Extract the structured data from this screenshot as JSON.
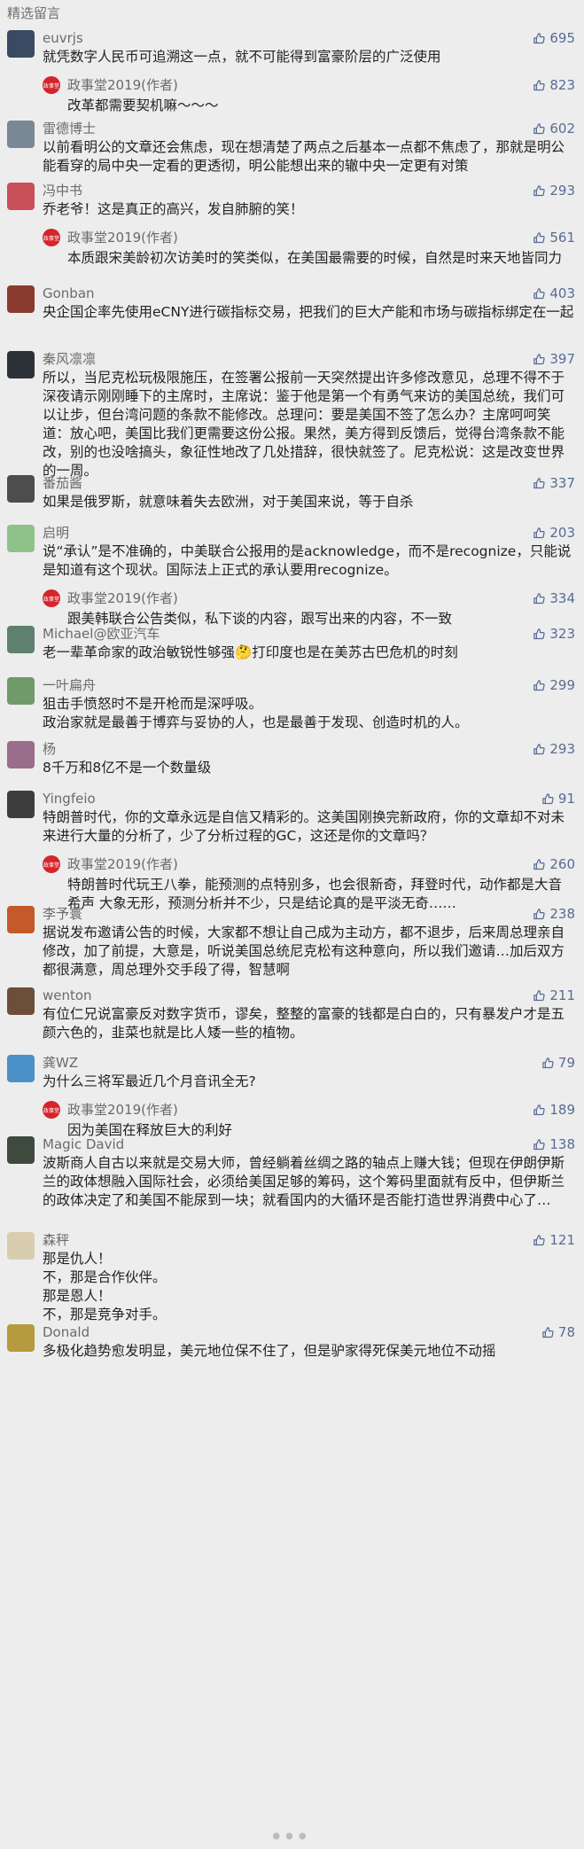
{
  "section_title": "精选留言",
  "comments": [
    {
      "nick": "euvrjs",
      "likes": "695",
      "text": "就凭数字人民币可追溯这一点，就不可能得到富豪阶层的广泛使用",
      "avatar_color": "#3a4a63",
      "reply": {
        "nick": "政事堂2019(作者)",
        "likes": "823",
        "text": "改革都需要契机嘛～～～"
      }
    },
    {
      "nick": "雷德博士",
      "likes": "602",
      "text": "以前看明公的文章还会焦虑，现在想清楚了两点之后基本一点都不焦虑了，那就是明公能看穿的局中央一定看的更透彻，明公能想出来的辙中央一定更有对策",
      "avatar_color": "#7a8794"
    },
    {
      "nick": "冯中书",
      "likes": "293",
      "text": "乔老爷！这是真正的高兴，发自肺腑的笑！",
      "avatar_color": "#c7505a",
      "reply": {
        "nick": "政事堂2019(作者)",
        "likes": "561",
        "text": "本质跟宋美龄初次访美时的笑类似，在美国最需要的时候，自然是时来天地皆同力"
      }
    },
    {
      "nick": "Gonban",
      "likes": "403",
      "text": "央企国企率先使用eCNY进行碳指标交易，把我们的巨大产能和市场与碳指标绑定在一起",
      "avatar_color": "#8a3a2e"
    },
    {
      "nick": "秦风凛凛",
      "likes": "397",
      "text": "所以，当尼克松玩极限施压，在签署公报前一天突然提出许多修改意见，总理不得不于深夜请示刚刚睡下的主席时，主席说：鉴于他是第一个有勇气来访的美国总统，我们可以让步，但台湾问题的条款不能修改。总理问：要是美国不签了怎么办？主席呵呵笑道：放心吧，美国比我们更需要这份公报。果然，美方得到反馈后，觉得台湾条款不能改，别的也没啥搞头，象征性地改了几处措辞，很快就签了。尼克松说：这是改变世界的一周。",
      "avatar_color": "#2d3238"
    },
    {
      "nick": "番茄酱",
      "likes": "337",
      "text": "如果是俄罗斯，就意味着失去欧洲，对于美国来说，等于自杀",
      "avatar_color": "#4d4d4d"
    },
    {
      "nick": "启明",
      "likes": "203",
      "text": "说“承认”是不准确的，中美联合公报用的是acknowledge，而不是recognize，只能说是知道有这个现状。国际法上正式的承认要用recognize。",
      "avatar_color": "#8fc18a",
      "reply": {
        "nick": "政事堂2019(作者)",
        "likes": "334",
        "text": "跟美韩联合公告类似，私下谈的内容，跟写出来的内容，不一致"
      }
    },
    {
      "nick": "Michael@欧亚汽车",
      "likes": "323",
      "text": "老一辈革命家的政治敏锐性够强🤔打印度也是在美苏古巴危机的时刻",
      "avatar_color": "#5f7f6f"
    },
    {
      "nick": "一叶扁舟",
      "likes": "299",
      "text": "狙击手愤怒时不是开枪而是深呼吸。\n政治家就是最善于博弈与妥协的人，也是最善于发现、创造时机的人。",
      "avatar_color": "#6f9a6a"
    },
    {
      "nick": "杨",
      "likes": "293",
      "text": "8千万和8亿不是一个数量级",
      "avatar_color": "#9a6d8a"
    },
    {
      "nick": "Yingfeio",
      "likes": "91",
      "text": "特朗普时代，你的文章永远是自信又精彩的。这美国刚换完新政府，你的文章却不对未来进行大量的分析了，少了分析过程的GC，这还是你的文章吗？",
      "avatar_color": "#3d3d3d",
      "reply": {
        "nick": "政事堂2019(作者)",
        "likes": "260",
        "text": "特朗普时代玩王八拳，能预测的点特别多，也会很新奇，拜登时代，动作都是大音希声 大象无形，预测分析并不少，只是结论真的是平淡无奇……"
      }
    },
    {
      "nick": "李予寰",
      "likes": "238",
      "text": "据说发布邀请公告的时候，大家都不想让自己成为主动方，都不退步，后来周总理亲自修改，加了前提，大意是，听说美国总统尼克松有这种意向，所以我们邀请…加后双方都很满意，周总理外交手段了得，智慧啊",
      "avatar_color": "#c45a2a"
    },
    {
      "nick": "wenton",
      "likes": "211",
      "text": "有位仁兄说富豪反对数字货币，谬矣，整整的富豪的钱都是白白的，只有暴发户才是五颜六色的，韭菜也就是比人矮一些的植物。",
      "avatar_color": "#6b4f3a"
    },
    {
      "nick": "龚WZ",
      "likes": "79",
      "text": "为什么三将军最近几个月音讯全无?",
      "avatar_color": "#4a90c9",
      "reply": {
        "nick": "政事堂2019(作者)",
        "likes": "189",
        "text": "因为美国在释放巨大的利好"
      }
    },
    {
      "nick": "Magic David",
      "likes": "138",
      "text": "波斯商人自古以来就是交易大师，曾经躺着丝绸之路的轴点上赚大钱；但现在伊朗伊斯兰的政体想融入国际社会，必须给美国足够的筹码，这个筹码里面就有反中，但伊斯兰的政体决定了和美国不能尿到一块；就看国内的大循环是否能打造世界消费中心了…",
      "avatar_color": "#3f4a3f"
    },
    {
      "nick": "森秤",
      "likes": "121",
      "text": "那是仇人！\n不，那是合作伙伴。\n那是恩人！\n不，那是竞争对手。",
      "avatar_color": "#d9cdb0"
    },
    {
      "nick": "Donald",
      "likes": "78",
      "text": "多极化趋势愈发明显，美元地位保不住了，但是驴家得死保美元地位不动摇",
      "avatar_color": "#b59a3e"
    }
  ],
  "reply_avatar_text": "政事堂",
  "icons": {
    "like": "thumbs-up-icon"
  },
  "colors": {
    "like": "#576b95",
    "background": "#ededed"
  }
}
